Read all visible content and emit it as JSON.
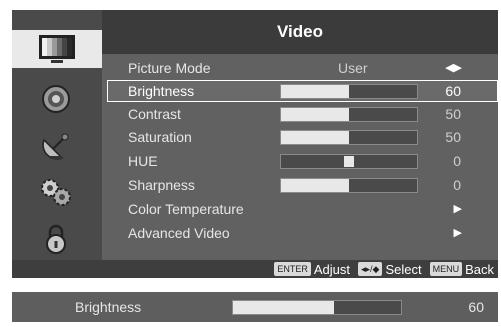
{
  "title": "Video",
  "sidebar": {
    "items": [
      {
        "icon": "tv-picture-icon",
        "active": true
      },
      {
        "icon": "speaker-icon",
        "active": false
      },
      {
        "icon": "satellite-dish-icon",
        "active": false
      },
      {
        "icon": "gears-icon",
        "active": false
      },
      {
        "icon": "lock-icon",
        "active": false
      }
    ]
  },
  "menu": {
    "rows": [
      {
        "label": "Picture Mode",
        "value": "User",
        "kind": "arrows",
        "arrows": "◀▶"
      },
      {
        "label": "Brightness",
        "value": "60",
        "kind": "bar",
        "level": 0.5,
        "selected": true
      },
      {
        "label": "Contrast",
        "value": "50",
        "kind": "bar",
        "level": 0.5
      },
      {
        "label": "Saturation",
        "value": "50",
        "kind": "bar",
        "level": 0.5
      },
      {
        "label": "HUE",
        "value": "0",
        "kind": "center",
        "level": 0.5
      },
      {
        "label": "Sharpness",
        "value": "0",
        "kind": "bar",
        "level": 0.5
      },
      {
        "label": "Color Temperature",
        "kind": "submenu",
        "arrow": "▶"
      },
      {
        "label": "Advanced Video",
        "kind": "submenu",
        "arrow": "▶"
      }
    ]
  },
  "footer": {
    "enter_key": "ENTER",
    "enter_label": "Adjust",
    "nav_key": "◂▸/◆",
    "nav_label": "Select",
    "menu_key": "MENU",
    "menu_label": "Back"
  },
  "bottom_bar": {
    "label": "Brightness",
    "value": "60",
    "level": 0.6
  },
  "colors": {
    "panel": "#585858",
    "title_bar": "#3b3b3b",
    "menu_bg": "#616161",
    "active_tab": "#e9e9e9",
    "bar_fill": "#e8e8e8"
  }
}
